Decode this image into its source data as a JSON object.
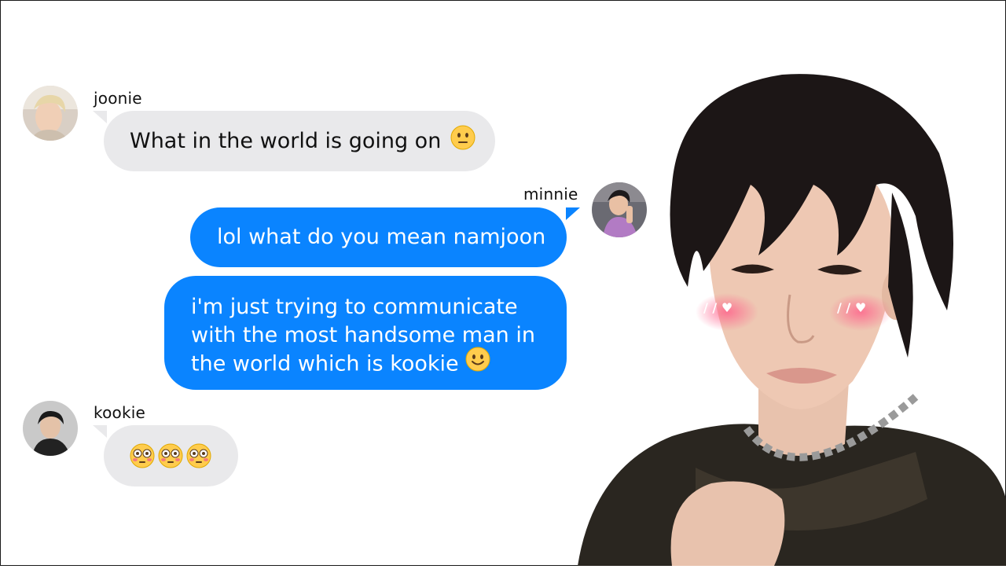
{
  "chat": {
    "messages": [
      {
        "sender": "joonie",
        "direction": "incoming",
        "text": "What in the world is going on",
        "emoji": "neutral-face"
      },
      {
        "sender": "minnie",
        "direction": "outgoing",
        "text": "lol what do you mean namjoon"
      },
      {
        "sender": "minnie",
        "direction": "outgoing",
        "lines": [
          "i'm just trying to communicate",
          "with the most handsome man in",
          "the world which is kookie"
        ],
        "emoji": "slightly-smiling-face"
      },
      {
        "sender": "kookie",
        "direction": "incoming",
        "emojis": [
          "flushed-face",
          "flushed-face",
          "flushed-face"
        ]
      }
    ]
  },
  "colors": {
    "incoming_bubble": "#e9e9eb",
    "outgoing_bubble": "#0a84ff",
    "background": "#ffffff"
  },
  "photo": {
    "blush_marks": [
      "/ / ♥",
      "/ / ♥"
    ]
  }
}
